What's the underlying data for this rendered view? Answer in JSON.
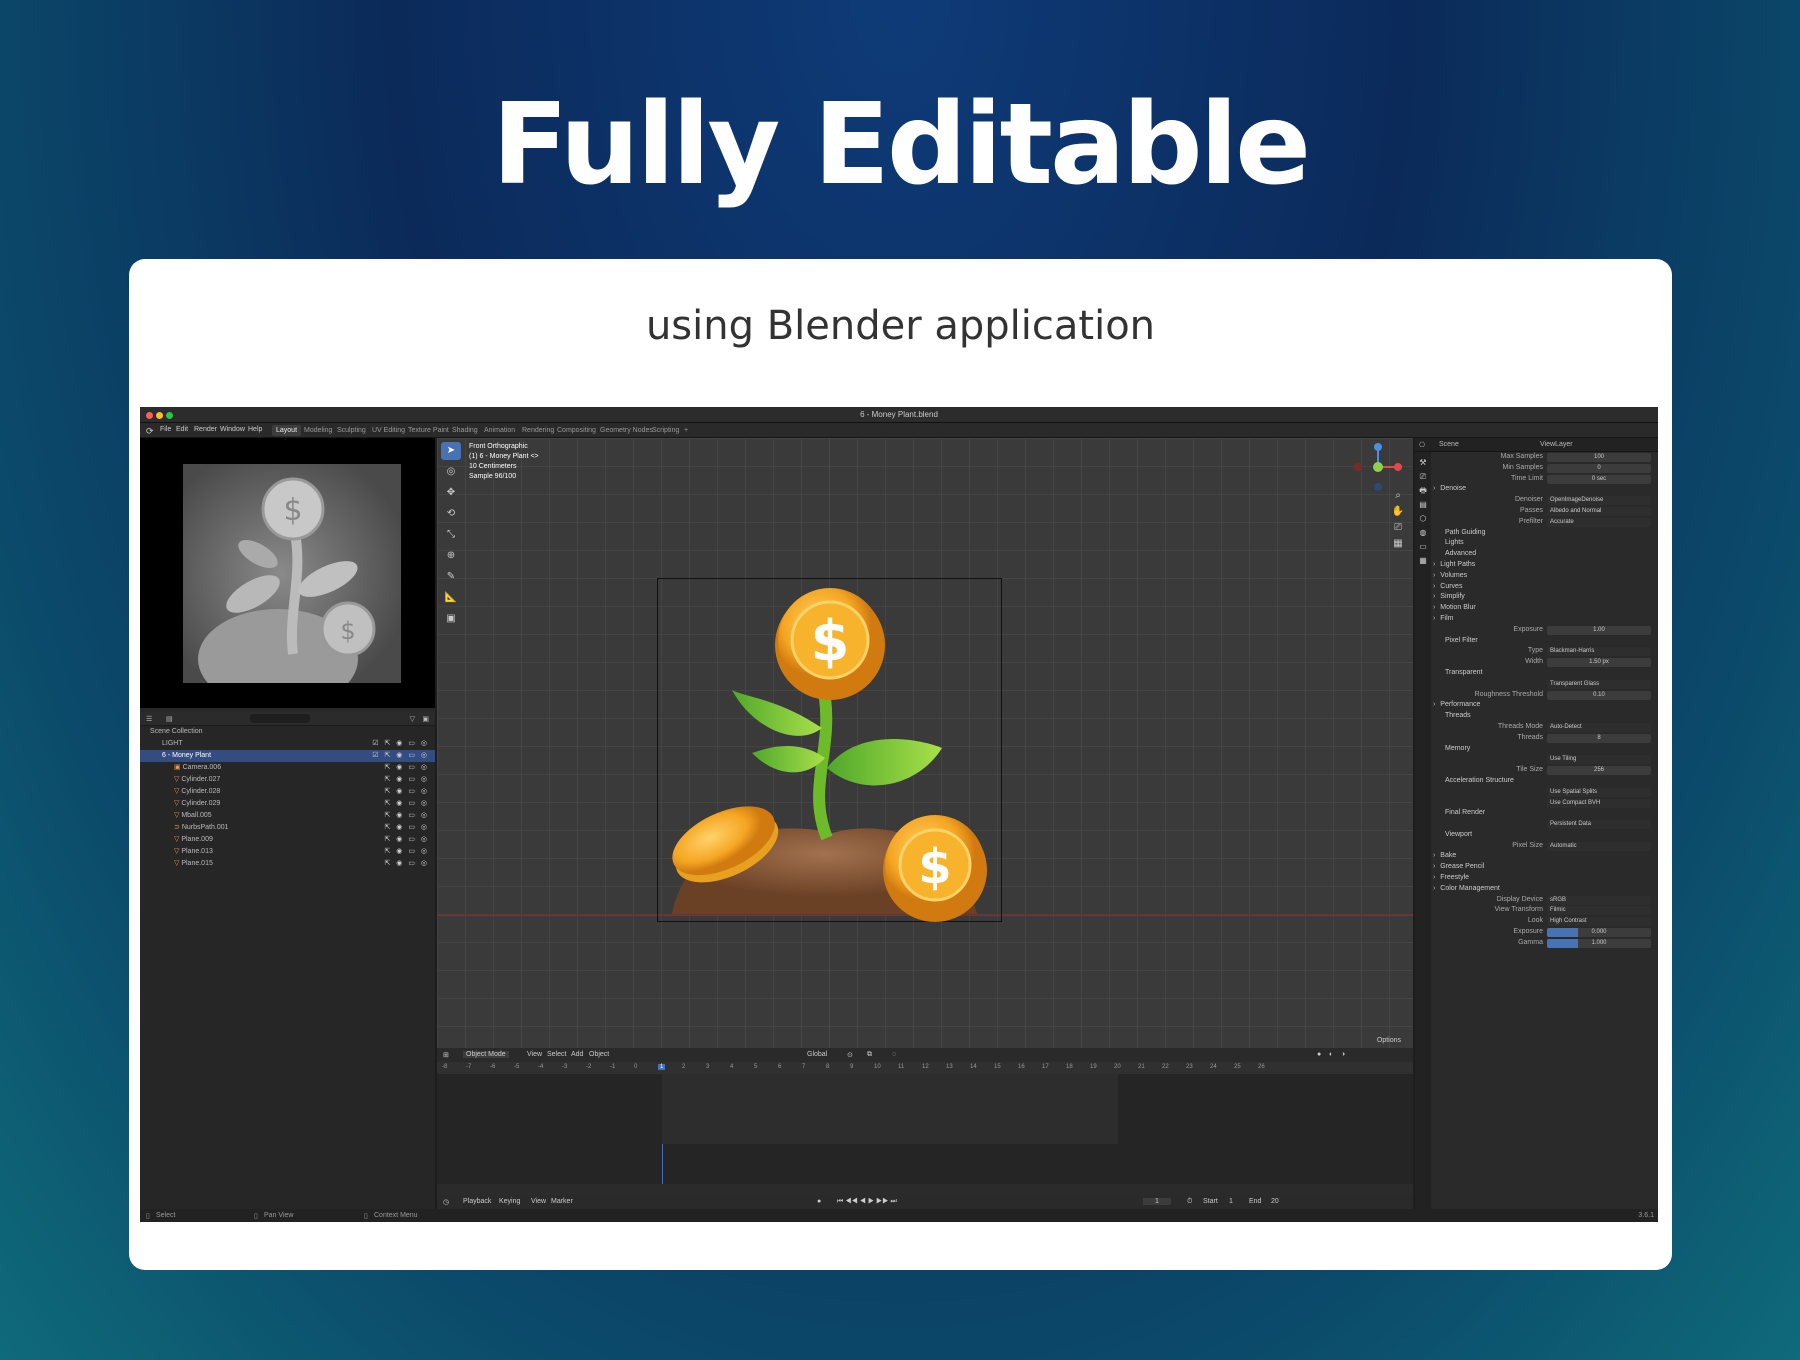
{
  "hero_title": "Fully Editable",
  "subtitle": "using Blender application",
  "app": {
    "window_title": "6 - Money Plant.blend",
    "menu": [
      "File",
      "Edit",
      "Render",
      "Window",
      "Help"
    ],
    "workspaces": [
      "Layout",
      "Modeling",
      "Sculpting",
      "UV Editing",
      "Texture Paint",
      "Shading",
      "Animation",
      "Rendering",
      "Compositing",
      "Geometry Nodes",
      "Scripting"
    ],
    "active_workspace": "Layout",
    "outliner": {
      "root": "Scene Collection",
      "rows": [
        "LIGHT",
        "6 - Money Plant",
        "Camera.006",
        "Cylinder.027",
        "Cylinder.028",
        "Cylinder.029",
        "Mball.005",
        "NurbsPath.001",
        "Plane.009",
        "Plane.013",
        "Plane.015"
      ]
    },
    "viewport": {
      "info": [
        "Front Orthographic",
        "(1) 6 - Money Plant <>",
        "10 Centimeters",
        "Sample 96/100"
      ],
      "mode": "Object Mode",
      "menus": [
        "View",
        "Select",
        "Add",
        "Object"
      ],
      "transform": "Global",
      "options": "Options"
    },
    "timeline": {
      "ticks": [
        "-8",
        "-7",
        "-6",
        "-5",
        "-4",
        "-3",
        "-2",
        "-1",
        "0",
        "1",
        "2",
        "3",
        "4",
        "5",
        "6",
        "7",
        "8",
        "9",
        "10",
        "11",
        "12",
        "13",
        "14",
        "15",
        "16",
        "17",
        "18",
        "19",
        "20",
        "21",
        "22",
        "23",
        "24",
        "25",
        "26"
      ],
      "current_frame": "1",
      "menus": [
        "Playback",
        "Keying",
        "View",
        "Marker"
      ],
      "start_label": "Start",
      "start": "1",
      "end_label": "End",
      "end": "20"
    },
    "properties": {
      "scene": "Scene",
      "view_layer": "ViewLayer",
      "rows": [
        {
          "k": "Max Samples",
          "v": "100"
        },
        {
          "k": "Min Samples",
          "v": "0"
        },
        {
          "k": "Time Limit",
          "v": "0 sec"
        },
        {
          "s": "Denoise"
        },
        {
          "k": "Denoiser",
          "v": "OpenImageDenoise",
          "dd": true
        },
        {
          "k": "Passes",
          "v": "Albedo and Normal",
          "dd": true
        },
        {
          "k": "Prefilter",
          "v": "Accurate",
          "dd": true
        },
        {
          "sub": "Path Guiding"
        },
        {
          "sub": "Lights"
        },
        {
          "sub": "Advanced"
        },
        {
          "s": "Light Paths"
        },
        {
          "s": "Volumes"
        },
        {
          "s": "Curves"
        },
        {
          "s": "Simplify"
        },
        {
          "s": "Motion Blur"
        },
        {
          "s": "Film"
        },
        {
          "k": "Exposure",
          "v": "1.00"
        },
        {
          "sub": "Pixel Filter"
        },
        {
          "k": "Type",
          "v": "Blackman-Harris",
          "dd": true
        },
        {
          "k": "Width",
          "v": "1.50 px"
        },
        {
          "sub": "Transparent"
        },
        {
          "k": "",
          "v": "Transparent Glass",
          "dd": true
        },
        {
          "k": "Roughness Threshold",
          "v": "0.10"
        },
        {
          "s": "Performance"
        },
        {
          "sub": "Threads"
        },
        {
          "k": "Threads Mode",
          "v": "Auto-Detect",
          "dd": true
        },
        {
          "k": "Threads",
          "v": "8"
        },
        {
          "sub": "Memory"
        },
        {
          "k": "",
          "v": "Use Tiling",
          "dd": true
        },
        {
          "k": "Tile Size",
          "v": "256"
        },
        {
          "sub": "Acceleration Structure"
        },
        {
          "k": "",
          "v": "Use Spatial Splits",
          "dd": true
        },
        {
          "k": "",
          "v": "Use Compact BVH",
          "dd": true
        },
        {
          "sub": "Final Render"
        },
        {
          "k": "",
          "v": "Persistent Data",
          "dd": true
        },
        {
          "sub": "Viewport"
        },
        {
          "k": "Pixel Size",
          "v": "Automatic",
          "dd": true
        },
        {
          "s": "Bake"
        },
        {
          "s": "Grease Pencil"
        },
        {
          "s": "Freestyle"
        },
        {
          "s": "Color Management"
        },
        {
          "k": "Display Device",
          "v": "sRGB",
          "dd": true
        },
        {
          "k": "View Transform",
          "v": "Filmic",
          "dd": true
        },
        {
          "k": "Look",
          "v": "High Contrast",
          "dd": true
        },
        {
          "k": "Exposure",
          "v": "0.000",
          "blue": true
        },
        {
          "k": "Gamma",
          "v": "1.000",
          "blue": true
        }
      ]
    },
    "status": {
      "select": "Select",
      "pan": "Pan View",
      "context": "Context Menu",
      "version": "3.6.1"
    }
  }
}
